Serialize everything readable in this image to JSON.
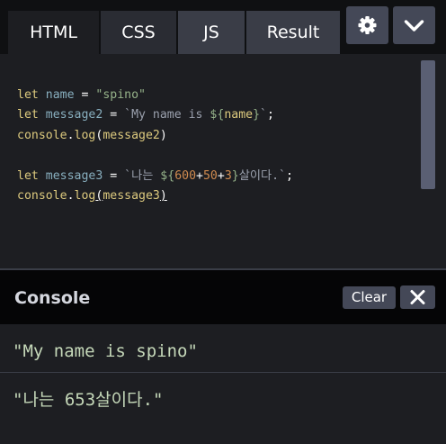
{
  "tabs": {
    "html": "HTML",
    "css": "CSS",
    "js": "JS",
    "result": "Result"
  },
  "toolbar": {
    "settings_icon": "gear-icon",
    "collapse_icon": "chevron-down-icon"
  },
  "code": {
    "line1": {
      "kw": "let",
      "sp1": " ",
      "var": "name",
      "eq": " = ",
      "str": "\"spino\""
    },
    "line2": {
      "kw": "let",
      "sp1": " ",
      "var": "message2",
      "eq": " = ",
      "tpl_start": "`My name is ",
      "interp_open": "${",
      "interp_var": "name",
      "interp_close": "}",
      "tpl_end": "`",
      "semi": ";"
    },
    "line3": {
      "obj": "console",
      "dot": ".",
      "fn": "log",
      "po": "(",
      "arg": "message2",
      "pc": ")"
    },
    "line5": {
      "kw": "let",
      "sp1": " ",
      "var": "message3",
      "eq": " = ",
      "tpl_start": "`나는 ",
      "interp_open": "${",
      "n1": "600",
      "plus1": "+",
      "n2": "50",
      "plus2": "+",
      "n3": "3",
      "interp_close": "}",
      "tpl_rest": "살이다.`",
      "semi": ";"
    },
    "line6": {
      "obj": "console",
      "dot": ".",
      "fn": "log",
      "po": "(",
      "arg": "message3",
      "pc": ")"
    }
  },
  "console": {
    "title": "Console",
    "clear_label": "Clear",
    "close_icon": "close-icon",
    "logs": [
      "\"My name is spino\"",
      "\"나는 653살이다.\""
    ]
  },
  "colors": {
    "background": "#1d1e22",
    "tab_active": "#1d1e22",
    "tab_inactive": "#3a3d47",
    "button": "#444857",
    "keyword": "#ddca7e",
    "variable": "#88afbf",
    "string": "#96b38a",
    "number": "#d08b4f",
    "log_text": "#c5d8b9"
  }
}
